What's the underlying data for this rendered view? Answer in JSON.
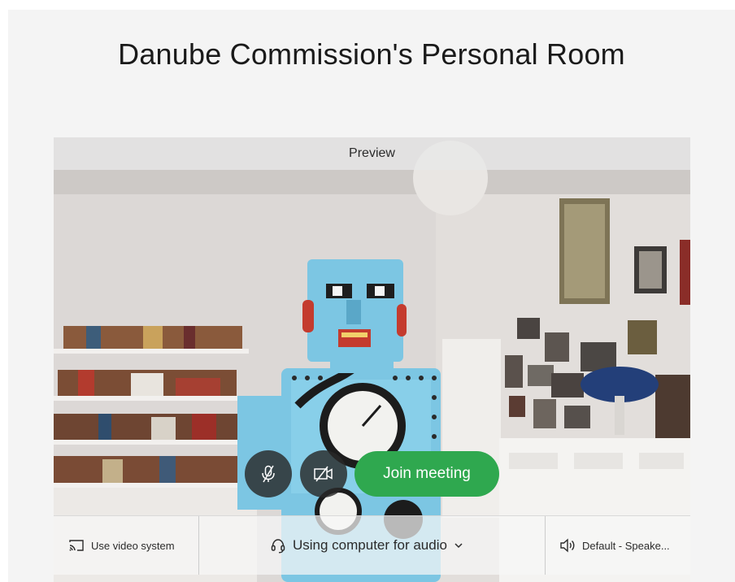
{
  "room": {
    "title": "Danube Commission's Personal Room"
  },
  "preview": {
    "header": "Preview",
    "controls": {
      "mute_icon": "microphone-muted-icon",
      "video_icon": "video-off-icon",
      "join_label": "Join meeting"
    }
  },
  "footer": {
    "video_system_label": "Use video system",
    "video_system_icon": "cast-screen-icon",
    "audio_label": "Using computer for audio",
    "audio_icon": "headset-icon",
    "speaker_label": "Default - Speake...",
    "speaker_icon": "speaker-icon"
  },
  "colors": {
    "join_button": "#2fa84f",
    "control_button": "#282828",
    "background": "#f4f4f4"
  }
}
